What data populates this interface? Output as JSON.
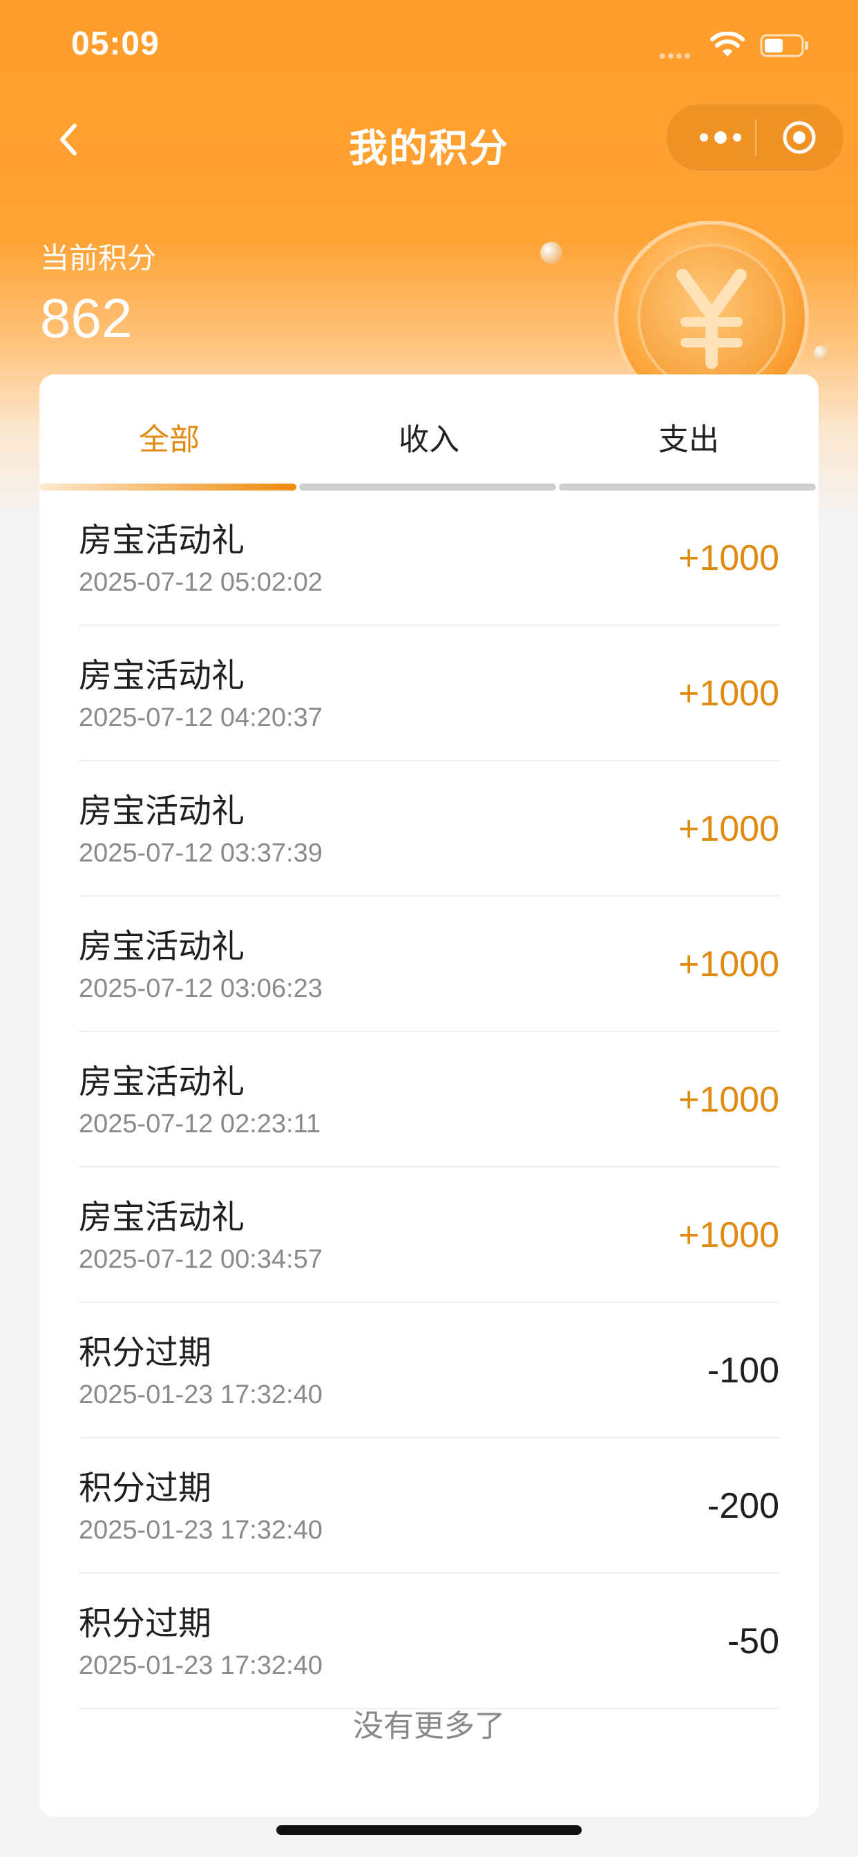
{
  "status_bar": {
    "time": "05:09"
  },
  "nav": {
    "title": "我的积分"
  },
  "summary": {
    "label": "当前积分",
    "value": "862"
  },
  "tabs": [
    {
      "label": "全部",
      "active": true
    },
    {
      "label": "收入",
      "active": false
    },
    {
      "label": "支出",
      "active": false
    }
  ],
  "records": [
    {
      "name": "房宝活动礼",
      "date": "2025-07-12 05:02:02",
      "amount": "+1000",
      "type": "income"
    },
    {
      "name": "房宝活动礼",
      "date": "2025-07-12 04:20:37",
      "amount": "+1000",
      "type": "income"
    },
    {
      "name": "房宝活动礼",
      "date": "2025-07-12 03:37:39",
      "amount": "+1000",
      "type": "income"
    },
    {
      "name": "房宝活动礼",
      "date": "2025-07-12 03:06:23",
      "amount": "+1000",
      "type": "income"
    },
    {
      "name": "房宝活动礼",
      "date": "2025-07-12 02:23:11",
      "amount": "+1000",
      "type": "income"
    },
    {
      "name": "房宝活动礼",
      "date": "2025-07-12 00:34:57",
      "amount": "+1000",
      "type": "income"
    },
    {
      "name": "积分过期",
      "date": "2025-01-23 17:32:40",
      "amount": "-100",
      "type": "expense"
    },
    {
      "name": "积分过期",
      "date": "2025-01-23 17:32:40",
      "amount": "-200",
      "type": "expense"
    },
    {
      "name": "积分过期",
      "date": "2025-01-23 17:32:40",
      "amount": "-50",
      "type": "expense"
    }
  ],
  "footer": {
    "no_more": "没有更多了"
  },
  "colors": {
    "brand": "#ff9d2a",
    "accent": "#e08a10",
    "text": "#1f1f1f",
    "muted": "#8a8a8a"
  },
  "icons": [
    "back-icon",
    "more-icon",
    "target-icon",
    "wifi-icon",
    "battery-icon",
    "coin-icon"
  ]
}
